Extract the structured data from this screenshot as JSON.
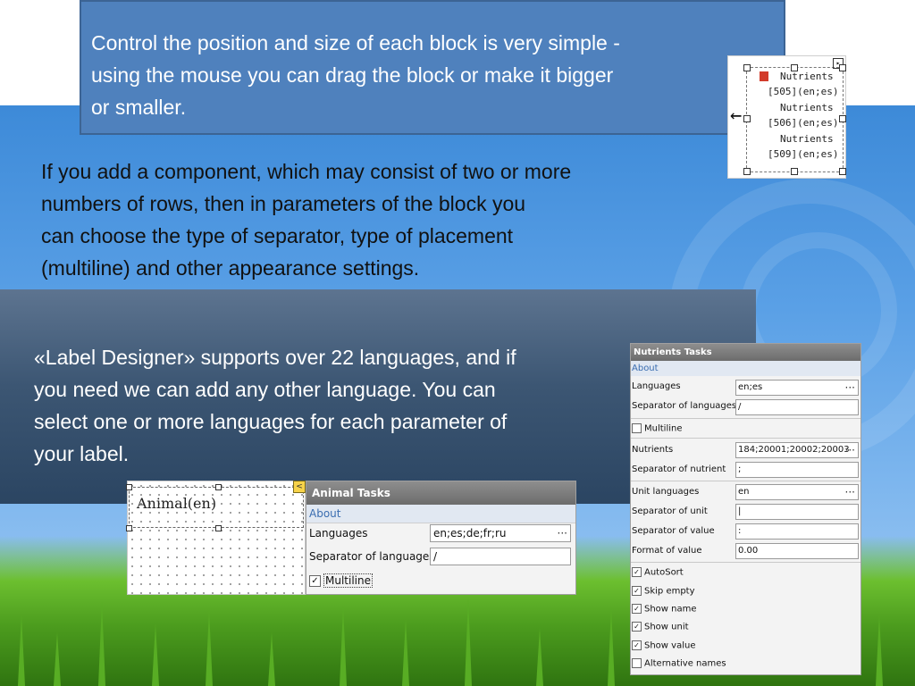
{
  "top_note": "Control the position and size of each block is very simple -\n using the mouse you can drag the block or make it bigger\nor smaller.",
  "middle_note": "If you add a component, which may consist of two or more\nnumbers of rows, then in parameters of the block you\ncan choose the type of separator, type of placement\n(multiline) and other appearance settings.",
  "band_note": "«Label Designer» supports over 22 languages, and if\nyou need we can add any other language. You can\nselect one or more languages for each parameter of\nyour label.",
  "block_preview": {
    "lines": [
      "Nutrients",
      "[505](en;es)",
      "Nutrients",
      "[506](en;es)",
      "Nutrients",
      "[509](en;es)"
    ]
  },
  "animal_designer": {
    "label": "Animal(en)",
    "smart_tag": "<"
  },
  "animal_tasks": {
    "title": "Animal Tasks",
    "about": "About",
    "languages_label": "Languages",
    "languages_value": "en;es;de;fr;ru",
    "separator_label": "Separator of languages",
    "separator_value": "/",
    "multiline_label": "Multiline",
    "multiline_checked": true,
    "ellipsis": "···"
  },
  "nutrients_tasks": {
    "title": "Nutrients Tasks",
    "about": "About",
    "languages_label": "Languages",
    "languages_value": "en;es",
    "separator_languages_label": "Separator of languages",
    "separator_languages_value": "/",
    "multiline_label": "Multiline",
    "multiline_checked": false,
    "nutrients_label": "Nutrients",
    "nutrients_value": "184;20001;20002;20003",
    "separator_nutrient_label": "Separator of nutrient",
    "separator_nutrient_value": ";",
    "unit_languages_label": "Unit languages",
    "unit_languages_value": "en",
    "separator_unit_label": "Separator of unit",
    "separator_unit_value": "|",
    "separator_value_label": "Separator of value",
    "separator_value_value": ":",
    "format_value_label": "Format of value",
    "format_value_value": "0.00",
    "ellipsis": "···",
    "checks": [
      {
        "label": "AutoSort",
        "checked": true
      },
      {
        "label": "Skip empty",
        "checked": true
      },
      {
        "label": "Show name",
        "checked": true
      },
      {
        "label": "Show unit",
        "checked": true
      },
      {
        "label": "Show value",
        "checked": true
      },
      {
        "label": "Alternative names",
        "checked": false
      }
    ]
  },
  "colors": {
    "top_box": "#4f81bd",
    "band": "#3c5673",
    "task_header": "#7a7a7a",
    "about_link": "#3a6db0"
  }
}
